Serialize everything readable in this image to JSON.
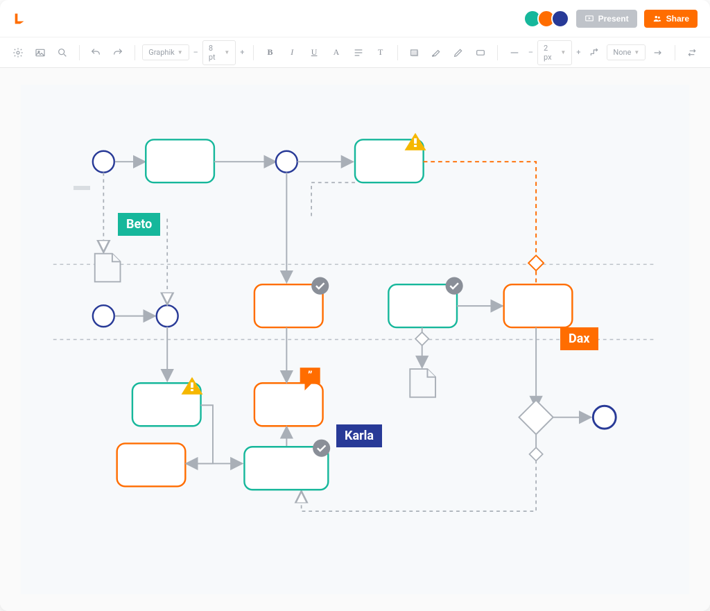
{
  "header": {
    "avatars": [
      "#16b79b",
      "#ff6d00",
      "#283a97"
    ],
    "present_label": "Present",
    "share_label": "Share"
  },
  "toolbar": {
    "font_family": "Graphik",
    "font_size": "8 pt",
    "stroke_width": "2 px",
    "line_style": "None"
  },
  "cursors": {
    "beto": {
      "label": "Beto",
      "color": "#16b79b"
    },
    "karla": {
      "label": "Karla",
      "color": "#283a97"
    },
    "dax": {
      "label": "Dax",
      "color": "#ff6d00"
    }
  },
  "colors": {
    "teal": "#16b79b",
    "orange": "#ff6d00",
    "navy": "#283a97",
    "grey": "#a9afb7",
    "warn": "#f5b700",
    "badge": "#8a8f98"
  }
}
